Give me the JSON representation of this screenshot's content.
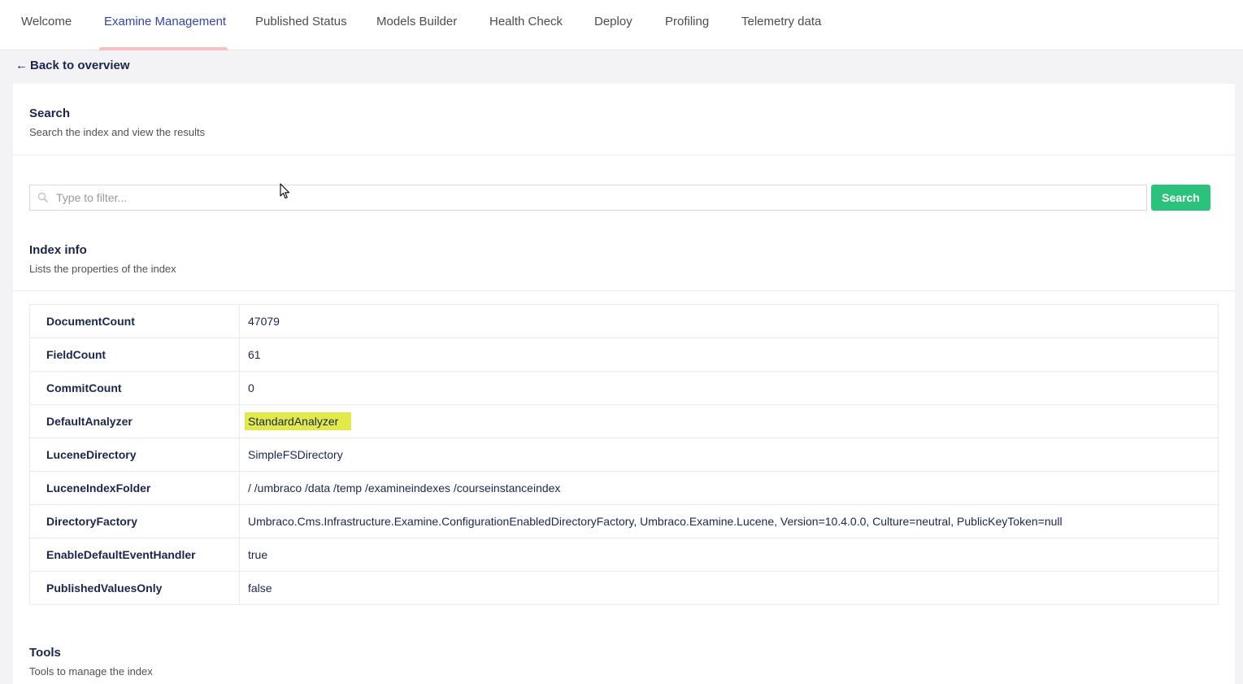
{
  "tabs": [
    {
      "label": "Welcome"
    },
    {
      "label": "Examine Management"
    },
    {
      "label": "Published Status"
    },
    {
      "label": "Models Builder"
    },
    {
      "label": "Health Check"
    },
    {
      "label": "Deploy"
    },
    {
      "label": "Profiling"
    },
    {
      "label": "Telemetry data"
    }
  ],
  "active_tab": "Examine Management",
  "back_link": {
    "arrow": "←",
    "label": "Back to overview"
  },
  "search_section": {
    "title": "Search",
    "description": "Search the index and view the results",
    "placeholder": "Type to filter...",
    "button_label": "Search"
  },
  "index_info": {
    "title": "Index info",
    "description": "Lists the properties of the index",
    "rows": [
      {
        "key": "DocumentCount",
        "value": "47079"
      },
      {
        "key": "FieldCount",
        "value": "61"
      },
      {
        "key": "CommitCount",
        "value": "0"
      },
      {
        "key": "DefaultAnalyzer",
        "value": "StandardAnalyzer"
      },
      {
        "key": "LuceneDirectory",
        "value": "SimpleFSDirectory"
      },
      {
        "key": "LuceneIndexFolder",
        "value": "/ /umbraco /data /temp /examineindexes /courseinstanceindex"
      },
      {
        "key": "DirectoryFactory",
        "value": "Umbraco.Cms.Infrastructure.Examine.ConfigurationEnabledDirectoryFactory, Umbraco.Examine.Lucene, Version=10.4.0.0, Culture=neutral, PublicKeyToken=null"
      },
      {
        "key": "EnableDefaultEventHandler",
        "value": "true"
      },
      {
        "key": "PublishedValuesOnly",
        "value": "false"
      }
    ]
  },
  "tools_section": {
    "title": "Tools",
    "description": "Tools to manage the index"
  },
  "colors": {
    "accent": "#3544b1",
    "tab_underline": "#f5c1bc",
    "search_button": "#2bc37c",
    "highlight": "#e2ea4a",
    "text": "#1b264f"
  },
  "icons": {
    "search_field": "search-icon",
    "cursor": "mouse-pointer-icon"
  }
}
